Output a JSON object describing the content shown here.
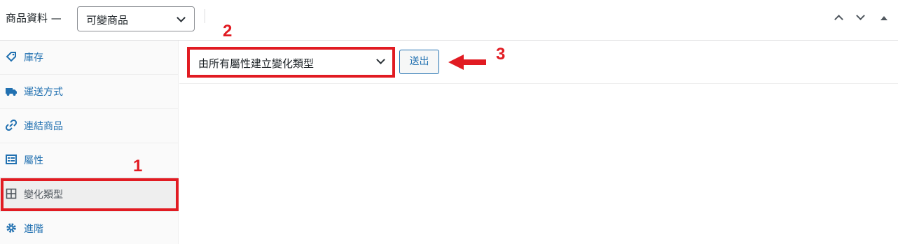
{
  "header": {
    "title": "商品資料 —",
    "product_type": "可變商品"
  },
  "sidebar": {
    "items": [
      {
        "label": "庫存",
        "icon": "tag-icon"
      },
      {
        "label": "運送方式",
        "icon": "truck-icon"
      },
      {
        "label": "連結商品",
        "icon": "link-icon"
      },
      {
        "label": "屬性",
        "icon": "list-icon"
      },
      {
        "label": "變化類型",
        "icon": "grid-icon",
        "active": true
      },
      {
        "label": "進階",
        "icon": "gear-icon"
      }
    ]
  },
  "variations": {
    "action_value": "由所有屬性建立變化類型",
    "go_label": "送出"
  },
  "annotations": {
    "marker_1": "1",
    "marker_2": "2",
    "marker_3": "3",
    "color": "#e11b22"
  },
  "colors": {
    "link": "#2271b1",
    "highlight": "#e11b22"
  }
}
